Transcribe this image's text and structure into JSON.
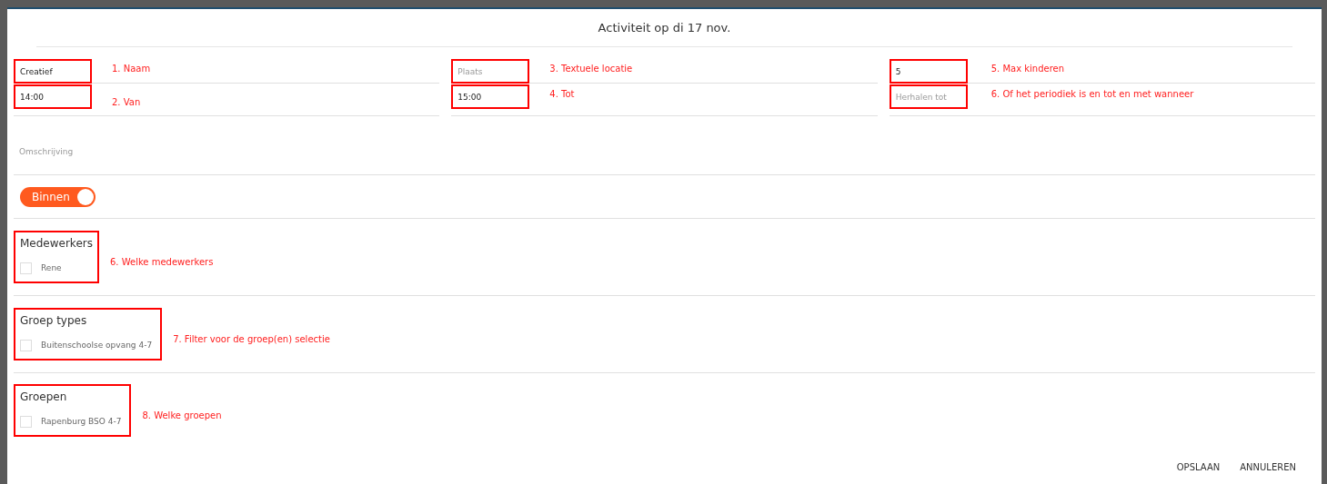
{
  "dialog": {
    "title": "Activiteit op di 17 nov."
  },
  "fields": [
    {
      "value": "Creatief",
      "annotation": "1. Naam"
    },
    {
      "placeholder": "Plaats",
      "annotation": "3. Textuele locatie"
    },
    {
      "value": "5",
      "annotation": "5. Max kinderen"
    },
    {
      "value": "14:00",
      "annotation": "2. Van"
    },
    {
      "value": "15:00",
      "annotation": "4. Tot"
    },
    {
      "placeholder": "Herhalen tot",
      "annotation": "6. Of het periodiek is en tot en met wanneer"
    }
  ],
  "description": {
    "placeholder": "Omschrijving"
  },
  "toggle": {
    "label": "Binnen",
    "on": true
  },
  "sections": [
    {
      "title": "Medewerkers",
      "items": [
        {
          "label": "Rene",
          "checked": false
        }
      ],
      "annotation": "6. Welke medewerkers"
    },
    {
      "title": "Groep types",
      "items": [
        {
          "label": "Buitenschoolse opvang 4-7",
          "checked": false
        }
      ],
      "annotation": "7. Filter voor de groep(en) selectie"
    },
    {
      "title": "Groepen",
      "items": [
        {
          "label": "Rapenburg BSO 4-7",
          "checked": false
        }
      ],
      "annotation": "8. Welke groepen"
    }
  ],
  "buttons": [
    "OPSLAAN",
    "ANNULEREN"
  ]
}
